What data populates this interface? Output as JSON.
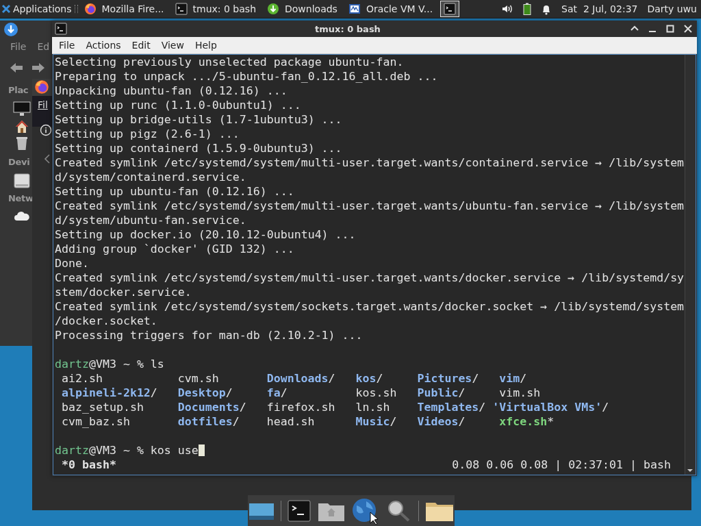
{
  "panel": {
    "apps_menu": "Applications",
    "tasks": [
      {
        "label": "Mozilla Fire...",
        "kind": "firefox",
        "selected": false
      },
      {
        "label": "tmux: 0 bash",
        "kind": "terminal",
        "selected": false
      },
      {
        "label": "Downloads",
        "kind": "download",
        "selected": false
      },
      {
        "label": "Oracle VM V...",
        "kind": "virtualbox",
        "selected": false
      },
      {
        "kind": "terminal",
        "selected": true
      }
    ],
    "clock": "Sat  2 Jul, 02:37",
    "user": "Darty uwu"
  },
  "file_manager": {
    "menu": [
      "File",
      "Ed"
    ],
    "sections": [
      "Plac",
      "Devi",
      "Netw"
    ]
  },
  "browser": {
    "menu": "Fil"
  },
  "terminal": {
    "title": "tmux: 0 bash",
    "menu": [
      "File",
      "Actions",
      "Edit",
      "View",
      "Help"
    ],
    "output": [
      "Selecting previously unselected package ubuntu-fan.",
      "Preparing to unpack .../5-ubuntu-fan_0.12.16_all.deb ...",
      "Unpacking ubuntu-fan (0.12.16) ...",
      "Setting up runc (1.1.0-0ubuntu1) ...",
      "Setting up bridge-utils (1.7-1ubuntu3) ...",
      "Setting up pigz (2.6-1) ...",
      "Setting up containerd (1.5.9-0ubuntu3) ...",
      "Created symlink /etc/systemd/system/multi-user.target.wants/containerd.service → /lib/system",
      "d/system/containerd.service.",
      "Setting up ubuntu-fan (0.12.16) ...",
      "Created symlink /etc/systemd/system/multi-user.target.wants/ubuntu-fan.service → /lib/system",
      "d/system/ubuntu-fan.service.",
      "Setting up docker.io (20.10.12-0ubuntu4) ...",
      "Adding group `docker' (GID 132) ...",
      "Done.",
      "Created symlink /etc/systemd/system/multi-user.target.wants/docker.service → /lib/systemd/sy",
      "stem/docker.service.",
      "Created symlink /etc/systemd/system/sockets.target.wants/docker.socket → /lib/systemd/system",
      "/docker.socket.",
      "Processing triggers for man-db (2.10.2-1) ..."
    ],
    "ls_prompt": {
      "user": "dartz",
      "command": "@VM3 ~ % ls"
    },
    "ls_rows": [
      [
        {
          "name": "ai2.sh",
          "kind": "file"
        },
        {
          "name": "cvm.sh",
          "kind": "file"
        },
        {
          "name": "Downloads",
          "suffix": "/",
          "kind": "dir"
        },
        {
          "name": "kos",
          "suffix": "/",
          "kind": "dir"
        },
        {
          "name": "Pictures",
          "suffix": "/",
          "kind": "dir"
        },
        {
          "name": "vim",
          "suffix": "/",
          "kind": "dir"
        }
      ],
      [
        {
          "name": "alpineli-2k12",
          "suffix": "/",
          "kind": "dir"
        },
        {
          "name": "Desktop",
          "suffix": "/",
          "kind": "dir"
        },
        {
          "name": "fa",
          "suffix": "/",
          "kind": "dir"
        },
        {
          "name": "kos.sh",
          "kind": "file"
        },
        {
          "name": "Public",
          "suffix": "/",
          "kind": "dir"
        },
        {
          "name": "vim.sh",
          "kind": "file"
        }
      ],
      [
        {
          "name": "baz_setup.sh",
          "kind": "file"
        },
        {
          "name": "Documents",
          "suffix": "/",
          "kind": "dir"
        },
        {
          "name": "firefox.sh",
          "kind": "file"
        },
        {
          "name": "ln.sh",
          "kind": "file"
        },
        {
          "name": "Templates",
          "suffix": "/",
          "kind": "dir"
        },
        {
          "name": "'VirtualBox VMs'",
          "suffix": "/",
          "kind": "quoted-dir"
        }
      ],
      [
        {
          "name": "cvm_baz.sh",
          "kind": "file"
        },
        {
          "name": "dotfiles",
          "suffix": "/",
          "kind": "dir"
        },
        {
          "name": "head.sh",
          "kind": "file"
        },
        {
          "name": "Music",
          "suffix": "/",
          "kind": "dir"
        },
        {
          "name": "Videos",
          "suffix": "/",
          "kind": "dir"
        },
        {
          "name": "xfce.sh",
          "suffix": "*",
          "kind": "exec"
        }
      ]
    ],
    "prompt": {
      "user": "dartz",
      "command": "@VM3 ~ % kos use"
    },
    "status": {
      "left": "*0 bash*",
      "right": "0.08 0.06 0.08 | 02:37:01 | bash"
    }
  }
}
